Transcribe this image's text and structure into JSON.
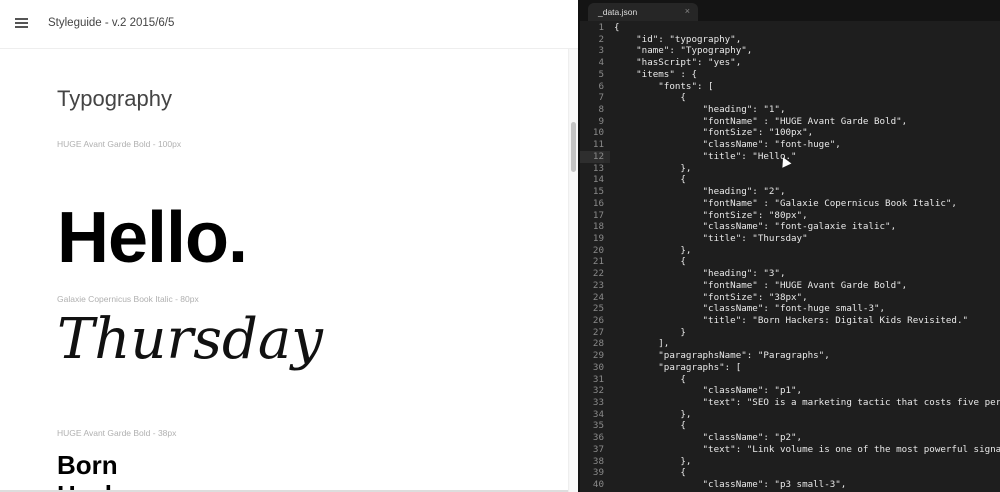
{
  "header": {
    "title": "Styleguide - v.2 2015/6/5",
    "menu_icon": "hamburger-icon"
  },
  "section": {
    "title": "Typography"
  },
  "samples": [
    {
      "label": "HUGE Avant Garde Bold - 100px",
      "text": "Hello."
    },
    {
      "label": "Galaxie Copernicus Book Italic - 80px",
      "text": "Thursday"
    },
    {
      "label": "HUGE Avant Garde Bold - 38px",
      "text": "Born Hackers"
    }
  ],
  "editor": {
    "tab": "_data.json",
    "close": "×",
    "current_line": 12,
    "lines": [
      "{",
      "    \"id\": \"typography\",",
      "    \"name\": \"Typography\",",
      "    \"hasScript\": \"yes\",",
      "    \"items\" : {",
      "        \"fonts\": [",
      "            {",
      "                \"heading\": \"1\",",
      "                \"fontName\" : \"HUGE Avant Garde Bold\",",
      "                \"fontSize\": \"100px\",",
      "                \"className\": \"font-huge\",",
      "                \"title\": \"Hello.\"",
      "            },",
      "            {",
      "                \"heading\": \"2\",",
      "                \"fontName\" : \"Galaxie Copernicus Book Italic\",",
      "                \"fontSize\": \"80px\",",
      "                \"className\": \"font-galaxie italic\",",
      "                \"title\": \"Thursday\"",
      "            },",
      "            {",
      "                \"heading\": \"3\",",
      "                \"fontName\" : \"HUGE Avant Garde Bold\",",
      "                \"fontSize\": \"38px\",",
      "                \"className\": \"font-huge small-3\",",
      "                \"title\": \"Born Hackers: Digital Kids Revisited.\"",
      "            }",
      "        ],",
      "        \"paragraphsName\": \"Paragraphs\",",
      "        \"paragraphs\": [",
      "            {",
      "                \"className\": \"p1\",",
      "                \"text\": \"SEO is a marketing tactic that costs five per",
      "            },",
      "            {",
      "                \"className\": \"p2\",",
      "                \"text\": \"Link volume is one of the most powerful signa",
      "            },",
      "            {",
      "                \"className\": \"p3 small-3\","
    ]
  }
}
